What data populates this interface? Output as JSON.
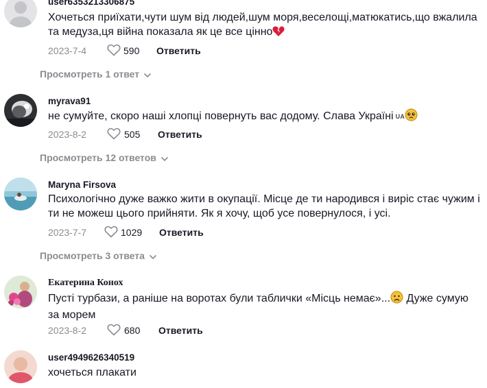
{
  "comments": [
    {
      "username": "user6353213306875",
      "text": "Хочеться приїхати,чути шум від людей,шум моря,веселощі,матюкатись,що вжалила та медуза,ця війна показала як це все цінно",
      "date": "2023-7-4",
      "likes": "590",
      "reply_label": "Ответить",
      "view_replies": "Просмотреть 1 ответ",
      "text_emoji": "broken-heart-icon"
    },
    {
      "username": "myrava91",
      "text": "не сумуйте, скоро наші хлопці повернуть вас додому. Слава Україні",
      "flag_text": "UA",
      "date": "2023-8-2",
      "likes": "505",
      "reply_label": "Ответить",
      "view_replies": "Просмотреть 12 ответов",
      "text_emoji": "pleading-face-icon"
    },
    {
      "username": "Maryna Firsova",
      "text": "Психологічно дуже важко жити в окупації. Місце де ти народився і виріс стає чужим і ти не можеш цього прийняти. Як я хочу, щоб усе повернулося, і усі.",
      "date": "2023-7-7",
      "likes": "1029",
      "reply_label": "Ответить",
      "view_replies": "Просмотреть 3 ответа"
    },
    {
      "username": "Екатерина Конох",
      "text_before": "Пусті турбази, а раніше на воротах були таблички «Місць немає»...",
      "text_after": " Дуже сумую за морем",
      "date": "2023-8-2",
      "likes": "680",
      "reply_label": "Ответить",
      "text_emoji": "sad-face-icon"
    },
    {
      "username": "user4949626340519",
      "text": "хочеться плакати"
    }
  ],
  "colors": {
    "text": "#161823",
    "muted": "#8a8b91",
    "heart": "#d81f3a"
  }
}
